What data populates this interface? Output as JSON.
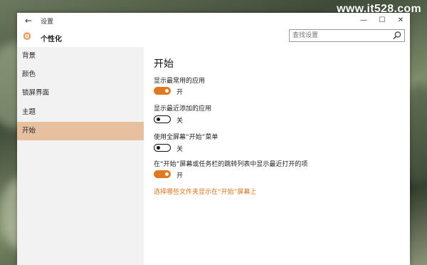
{
  "watermark": "www.it528.com",
  "window": {
    "title": "设置",
    "controls": {
      "minimize": "—",
      "maximize": "☐",
      "close": "✕"
    }
  },
  "header": {
    "title": "个性化",
    "search_placeholder": "查找设置"
  },
  "sidebar": {
    "items": [
      {
        "label": "背景"
      },
      {
        "label": "颜色"
      },
      {
        "label": "锁屏界面"
      },
      {
        "label": "主题"
      },
      {
        "label": "开始"
      }
    ],
    "active_index": 4
  },
  "content": {
    "title": "开始",
    "settings": [
      {
        "label": "显示最常用的应用",
        "state": "开",
        "on": true
      },
      {
        "label": "显示最近添加的应用",
        "state": "关",
        "on": false
      },
      {
        "label": "使用全屏幕“开始”菜单",
        "state": "关",
        "on": false
      },
      {
        "label": "在“开始”屏幕或任务栏的跳转列表中显示最近打开的项",
        "state": "开",
        "on": true
      }
    ],
    "link": "选择哪些文件夹显示在“开始”屏幕上"
  },
  "colors": {
    "accent": "#e07a22",
    "active_nav": "#e7c09f",
    "sidebar_bg": "#f2f2f2"
  }
}
